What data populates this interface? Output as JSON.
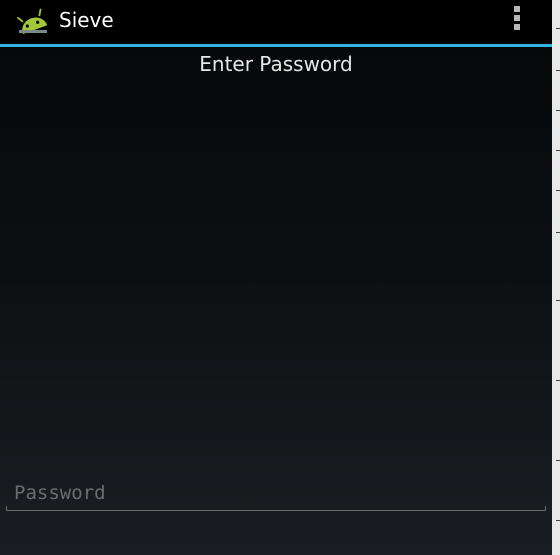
{
  "action_bar": {
    "title": "Sieve",
    "app_icon": "android-app-icon",
    "overflow_icon": "overflow-menu-icon",
    "divider_color": "#33b5e5"
  },
  "main": {
    "prompt": "Enter Password",
    "password_field": {
      "placeholder": "Password",
      "value": ""
    }
  }
}
